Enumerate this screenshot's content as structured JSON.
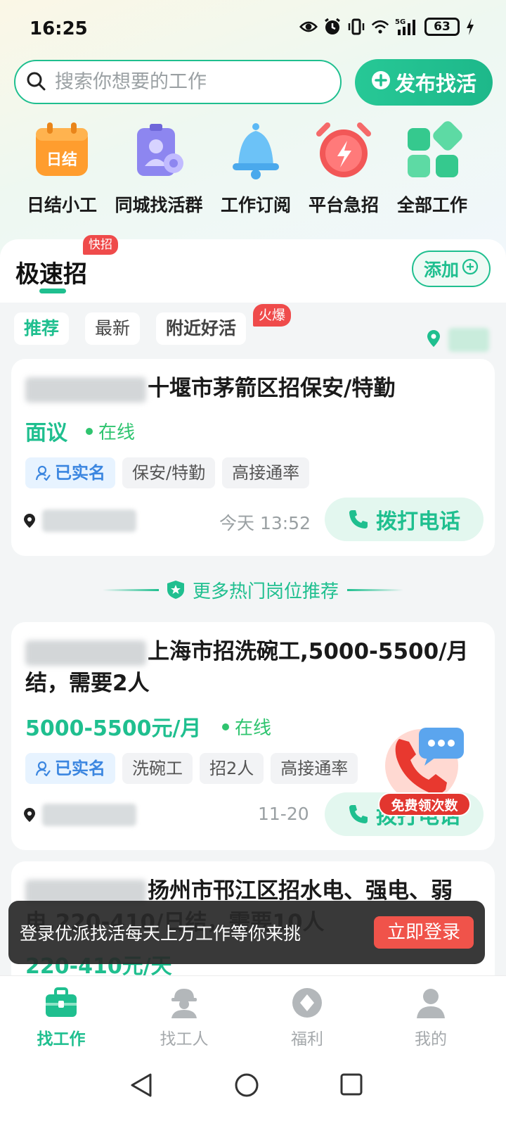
{
  "status_bar": {
    "time": "16:25",
    "battery": "63",
    "network": "5G"
  },
  "search": {
    "placeholder": "搜索你想要的工作"
  },
  "publish_button": {
    "label": "发布找活"
  },
  "quick_nav": [
    {
      "label": "日结小工",
      "icon": "calendar-rijie-icon",
      "icon_text": "日结"
    },
    {
      "label": "同城找活群",
      "icon": "id-badge-icon"
    },
    {
      "label": "工作订阅",
      "icon": "bell-icon"
    },
    {
      "label": "平台急招",
      "icon": "alarm-clock-icon"
    },
    {
      "label": "全部工作",
      "icon": "grid-apps-icon"
    }
  ],
  "speed_recruit": {
    "title": "极速招",
    "badge": "快招",
    "add_label": "添加"
  },
  "filters": [
    {
      "label": "推荐",
      "active": true
    },
    {
      "label": "最新",
      "active": false
    },
    {
      "label": "附近好活",
      "active": false,
      "badge": "火爆"
    }
  ],
  "jobs": [
    {
      "title": "十堰市茅箭区招保安/特勤",
      "salary": "面议",
      "status": "在线",
      "tags": [
        "已实名",
        "保安/特勤",
        "高接通率"
      ],
      "time": "今天 13:52",
      "call_label": "拨打电话"
    },
    {
      "title": "上海市招洗碗工,5000-5500/月结，需要2人",
      "salary": "5000-5500元/月",
      "status": "在线",
      "tags": [
        "已实名",
        "洗碗工",
        "招2人",
        "高接通率"
      ],
      "time": "11-20",
      "call_label": "拨打电话"
    },
    {
      "title": "扬州市邗江区招水电、强电、弱电,220-410/日结，需要10人",
      "salary": "220-410元/天"
    }
  ],
  "more_recommend": "更多热门岗位推荐",
  "float_badge": {
    "label": "免费领次数"
  },
  "login_toast": {
    "message": "登录优派找活每天上万工作等你来挑",
    "button": "立即登录"
  },
  "bottom_nav": [
    {
      "label": "找工作",
      "icon": "briefcase-icon",
      "active": true
    },
    {
      "label": "找工人",
      "icon": "worker-icon",
      "active": false
    },
    {
      "label": "福利",
      "icon": "diamond-icon",
      "active": false
    },
    {
      "label": "我的",
      "icon": "person-icon",
      "active": false
    }
  ],
  "colors": {
    "primary": "#1fbf8f",
    "hot": "#ef4b4b",
    "verified": "#3b86e0",
    "online": "#2fc46f"
  }
}
